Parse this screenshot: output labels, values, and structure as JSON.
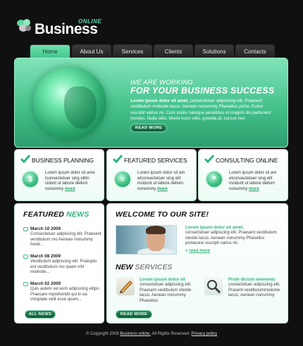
{
  "logo": {
    "brand": "Business",
    "tag": "ONLINE"
  },
  "nav": {
    "items": [
      "Home",
      "About Us",
      "Services",
      "Clients",
      "Solutions",
      "Contacts"
    ],
    "active": "Home"
  },
  "hero": {
    "subtitle": "WE ARE WORKING",
    "title": "FOR YOUR BUSINESS SUCCESS",
    "text_lead": "Lorem ipsum dolor sit amet,",
    "text": "consectetuer adipiscing elit. Praesent vestibulum molestie lacus. Aenean nonummy Phasellus porta. Fusce suscipit varius mi. Cum sociis natoque penatibus et magnis dis parturient montes. Nulla odio. Morbi nunc odio, gravida at, cursus nec",
    "button": "READ MORE"
  },
  "features": [
    {
      "title": "BUSINESS PLANNING",
      "icon": "dollar-icon",
      "icon_glyph": "$",
      "text": "Lorem ipsum dolor sit ame tconsectetuer sing ellitn cidunt ut labore dellum nonummy",
      "more": "more"
    },
    {
      "title": "FEATURED SERVICES",
      "icon": "document-icon",
      "icon_glyph": "≡",
      "text": "Lorem ipsum dolor sit am etconsectetuer sing elit incidunt ut labore dellum nonummy",
      "more": "more"
    },
    {
      "title": "CONSULTING ONLINE",
      "icon": "chat-icon",
      "icon_glyph": "❞",
      "text": "Lorem ipsum dolor sit am etconsectetuer sing elit incidunt ut labore dellum nonummy",
      "more": "more"
    }
  ],
  "news": {
    "title_a": "FEATURED",
    "title_b": "NEWS",
    "items": [
      {
        "date": "March 10 2009",
        "text": "Consectetuer adipiscing elit. Praesent vestibulum mo Aenean nonummy hend..."
      },
      {
        "date": "March 08 2009",
        "text": "Vestibulum adipiscing elit. Praesptu ent vestibulum mo quam nihl molestie..."
      },
      {
        "date": "March 02 2009",
        "text": "Quis autem vel eum adipiscing elitpo Praesare reprehendit qui in ea voluptate velit esse quam..."
      }
    ],
    "button": "ALL NEWS"
  },
  "welcome": {
    "title": "WELCOME TO OUR SITE!",
    "lead": "Lorem ipsum dolor sit amet,",
    "text": "consectetuer adipiscing elit. Praesent vestibulum olestie lacus. Aenean nonummy Phasellus portasuce suscipit varius mi.",
    "read_more": "read more",
    "services_a": "NEW",
    "services_b": "SERVICES",
    "services": [
      {
        "lead": "Lorem ipsum dolor sit",
        "text": "consectetuer adipiscing elit. Praesent vestibulum olestie lacus. Aenean nonummy Phasellus",
        "icon": "pencil-icon"
      },
      {
        "lead": "Proin dictum elementu",
        "text": "consectetuer adipiscing elit. Prasent vestibulummolestie lacus. Aenean nonummy",
        "icon": "magnifier-icon"
      }
    ],
    "button": "READ MORE"
  },
  "footer": {
    "copyright": "©  Copyright 2009",
    "site": "Business online.",
    "rights": "All Rights Reserved.",
    "policy": "Privacy policy"
  }
}
